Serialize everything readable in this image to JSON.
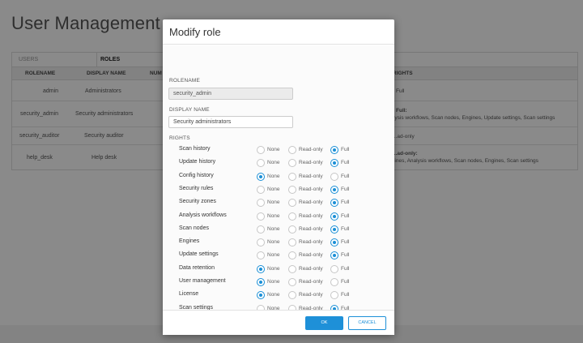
{
  "page": {
    "title": "User Management"
  },
  "tabs": {
    "users": "USERS",
    "roles": "ROLES"
  },
  "table": {
    "headers": {
      "rolename": "ROLENAME",
      "display_name": "DISPLAY NAME",
      "num": "NUM",
      "rights": "RIGHTS"
    },
    "rows": [
      {
        "rolename": "admin",
        "display_name": "Administrators",
        "rights_title": "Full",
        "rights_detail": ""
      },
      {
        "rolename": "security_admin",
        "display_name": "Security administrators",
        "rights_title": "Full:",
        "rights_detail": "...ysis workflows, Scan nodes, Engines, Update settings, Scan settings"
      },
      {
        "rolename": "security_auditor",
        "display_name": "Security auditor",
        "rights_title": "...ad-only",
        "rights_detail": ""
      },
      {
        "rolename": "help_desk",
        "display_name": "Help desk",
        "rights_title": "...ad-only:",
        "rights_detail": "...ines, Analysis workflows, Scan nodes, Engines, Scan settings"
      }
    ]
  },
  "modal": {
    "title": "Modify role",
    "rolename_label": "ROLENAME",
    "rolename_value": "security_admin",
    "display_name_label": "DISPLAY NAME",
    "display_name_value": "Security administrators",
    "rights_label": "RIGHTS",
    "option_labels": {
      "none": "None",
      "read_only": "Read-only",
      "full": "Full"
    },
    "rights": [
      {
        "name": "Scan history",
        "selected": "full"
      },
      {
        "name": "Update history",
        "selected": "full"
      },
      {
        "name": "Config history",
        "selected": "none"
      },
      {
        "name": "Security rules",
        "selected": "full"
      },
      {
        "name": "Security zones",
        "selected": "full"
      },
      {
        "name": "Analysis workflows",
        "selected": "full"
      },
      {
        "name": "Scan nodes",
        "selected": "full"
      },
      {
        "name": "Engines",
        "selected": "full"
      },
      {
        "name": "Update settings",
        "selected": "full"
      },
      {
        "name": "Data retention",
        "selected": "none"
      },
      {
        "name": "User management",
        "selected": "none"
      },
      {
        "name": "License",
        "selected": "none"
      },
      {
        "name": "Scan settings",
        "selected": "full"
      }
    ],
    "ok_label": "OK",
    "cancel_label": "CANCEL"
  },
  "colors": {
    "accent": "#1e90d8",
    "overlay": "rgba(0,0,0,0.46)"
  }
}
